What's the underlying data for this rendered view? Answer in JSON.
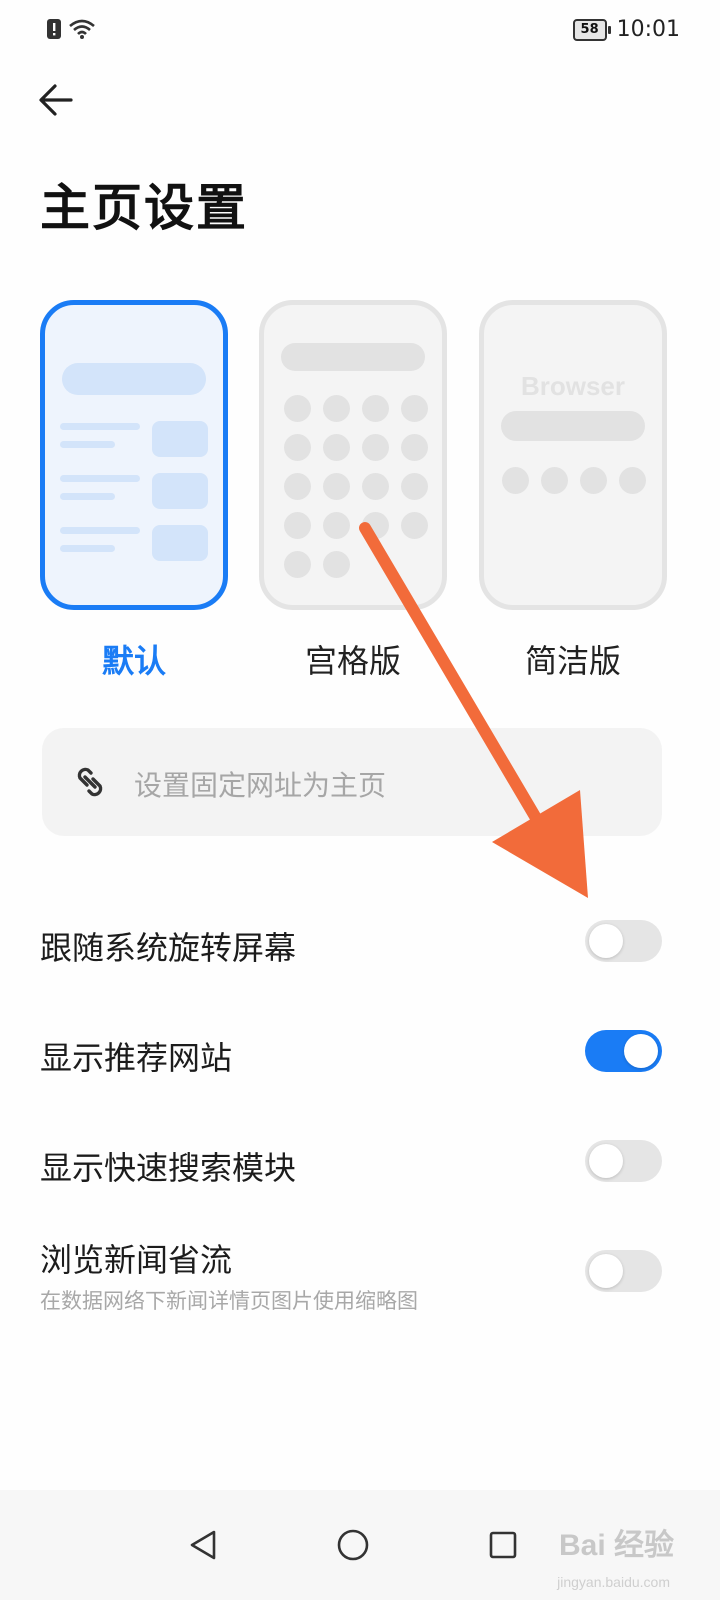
{
  "status_bar": {
    "battery_level": "58",
    "time": "10:01",
    "icons": [
      "sim-alert-icon",
      "wifi-icon",
      "battery-icon"
    ]
  },
  "header": {
    "back_icon": "arrow-left-icon",
    "title": "主页设置"
  },
  "layouts": {
    "selected": "默认",
    "options": [
      {
        "label": "默认",
        "selected": true
      },
      {
        "label": "宫格版",
        "selected": false
      },
      {
        "label": "简洁版",
        "selected": false,
        "preview_text": "Browser"
      }
    ]
  },
  "url_field": {
    "icon": "link-icon",
    "placeholder": "设置固定网址为主页",
    "value": ""
  },
  "settings": [
    {
      "label": "跟随系统旋转屏幕",
      "enabled": false
    },
    {
      "label": "显示推荐网站",
      "enabled": true
    },
    {
      "label": "显示快速搜索模块",
      "enabled": false
    },
    {
      "label": "浏览新闻省流",
      "description": "在数据网络下新闻详情页图片使用缩略图",
      "enabled": false
    }
  ],
  "nav_bar": {
    "icons": [
      "back-triangle-icon",
      "home-circle-icon",
      "recents-square-icon"
    ]
  },
  "watermark": {
    "text": "Bai 经验",
    "sub": "jingyan.baidu.com"
  },
  "colors": {
    "accent": "#1a7cf5",
    "arrow": "#f26b3a",
    "toggle_off": "#e5e5e5"
  }
}
